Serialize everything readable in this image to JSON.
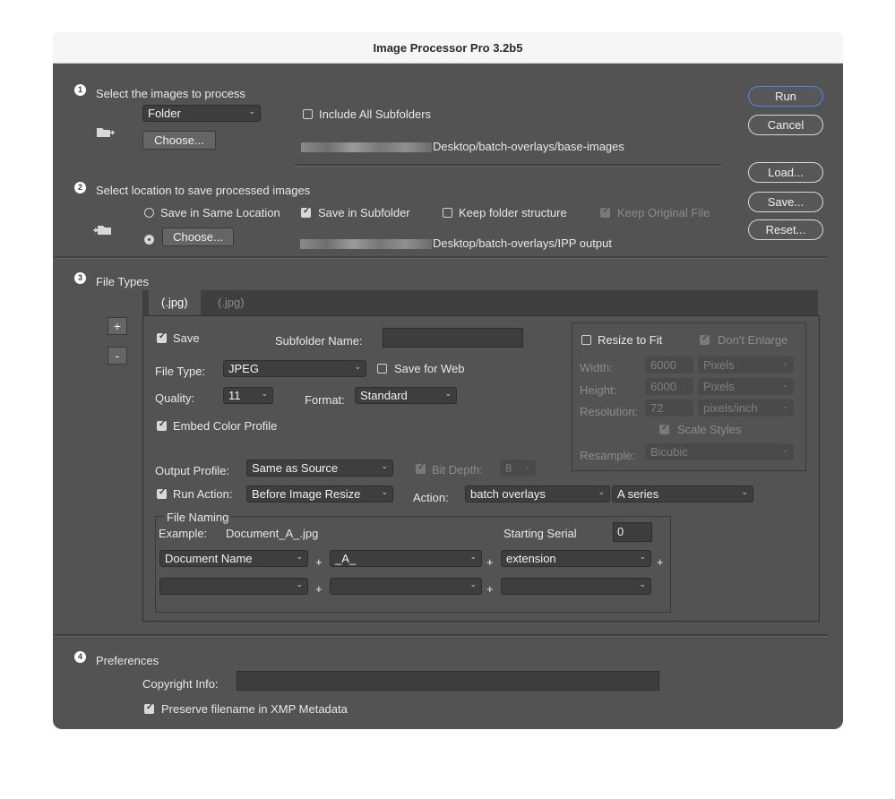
{
  "window": {
    "title": "Image Processor Pro 3.2b5"
  },
  "side_buttons": {
    "run": "Run",
    "cancel": "Cancel",
    "load": "Load...",
    "save": "Save...",
    "reset": "Reset..."
  },
  "section1": {
    "number": "1",
    "title": "Select the images to process",
    "source_select": "Folder",
    "include_subfolders_label": "Include All Subfolders",
    "include_subfolders_checked": false,
    "choose_label": "Choose...",
    "path": "Desktop/batch-overlays/base-images"
  },
  "section2": {
    "number": "2",
    "title": "Select location to save processed images",
    "same_location_label": "Save in Same Location",
    "save_in_subfolder_label": "Save in Subfolder",
    "keep_structure_label": "Keep folder structure",
    "keep_original_label": "Keep Original File",
    "choose_label": "Choose...",
    "path": "Desktop/batch-overlays/IPP output"
  },
  "section3": {
    "number": "3",
    "title": "File Types",
    "add_label": "+",
    "remove_label": "-",
    "tabs": [
      {
        "label": "(.jpg)"
      },
      {
        "label": "(.jpg)"
      }
    ],
    "save_label": "Save",
    "subfolder_name_label": "Subfolder Name:",
    "subfolder_name_value": "",
    "file_type_label": "File Type:",
    "file_type_value": "JPEG",
    "save_for_web_label": "Save for Web",
    "quality_label": "Quality:",
    "quality_value": "11",
    "format_label": "Format:",
    "format_value": "Standard",
    "embed_profile_label": "Embed Color Profile",
    "output_profile_label": "Output Profile:",
    "output_profile_value": "Same as Source",
    "bit_depth_label": "Bit Depth:",
    "bit_depth_value": "8",
    "run_action_label": "Run Action:",
    "run_action_value": "Before Image Resize",
    "action_label": "Action:",
    "action_set_value": "batch overlays",
    "action_value": "A series",
    "resize": {
      "resize_to_fit_label": "Resize to Fit",
      "dont_enlarge_label": "Don't Enlarge",
      "width_label": "Width:",
      "width_value": "6000",
      "width_unit": "Pixels",
      "height_label": "Height:",
      "height_value": "6000",
      "height_unit": "Pixels",
      "resolution_label": "Resolution:",
      "resolution_value": "72",
      "resolution_unit": "pixels/inch",
      "scale_styles_label": "Scale Styles",
      "resample_label": "Resample:",
      "resample_value": "Bicubic"
    },
    "naming": {
      "legend": "File Naming",
      "example_label": "Example:",
      "example_value": "Document_A_.jpg",
      "starting_serial_label": "Starting Serial",
      "starting_serial_value": "0",
      "plus": "+",
      "row1": [
        "Document Name",
        "_A_",
        "extension"
      ],
      "row2": [
        "",
        "",
        ""
      ]
    }
  },
  "section4": {
    "number": "4",
    "title": "Preferences",
    "copyright_label": "Copyright Info:",
    "copyright_value": "",
    "preserve_label": "Preserve filename in XMP Metadata"
  }
}
